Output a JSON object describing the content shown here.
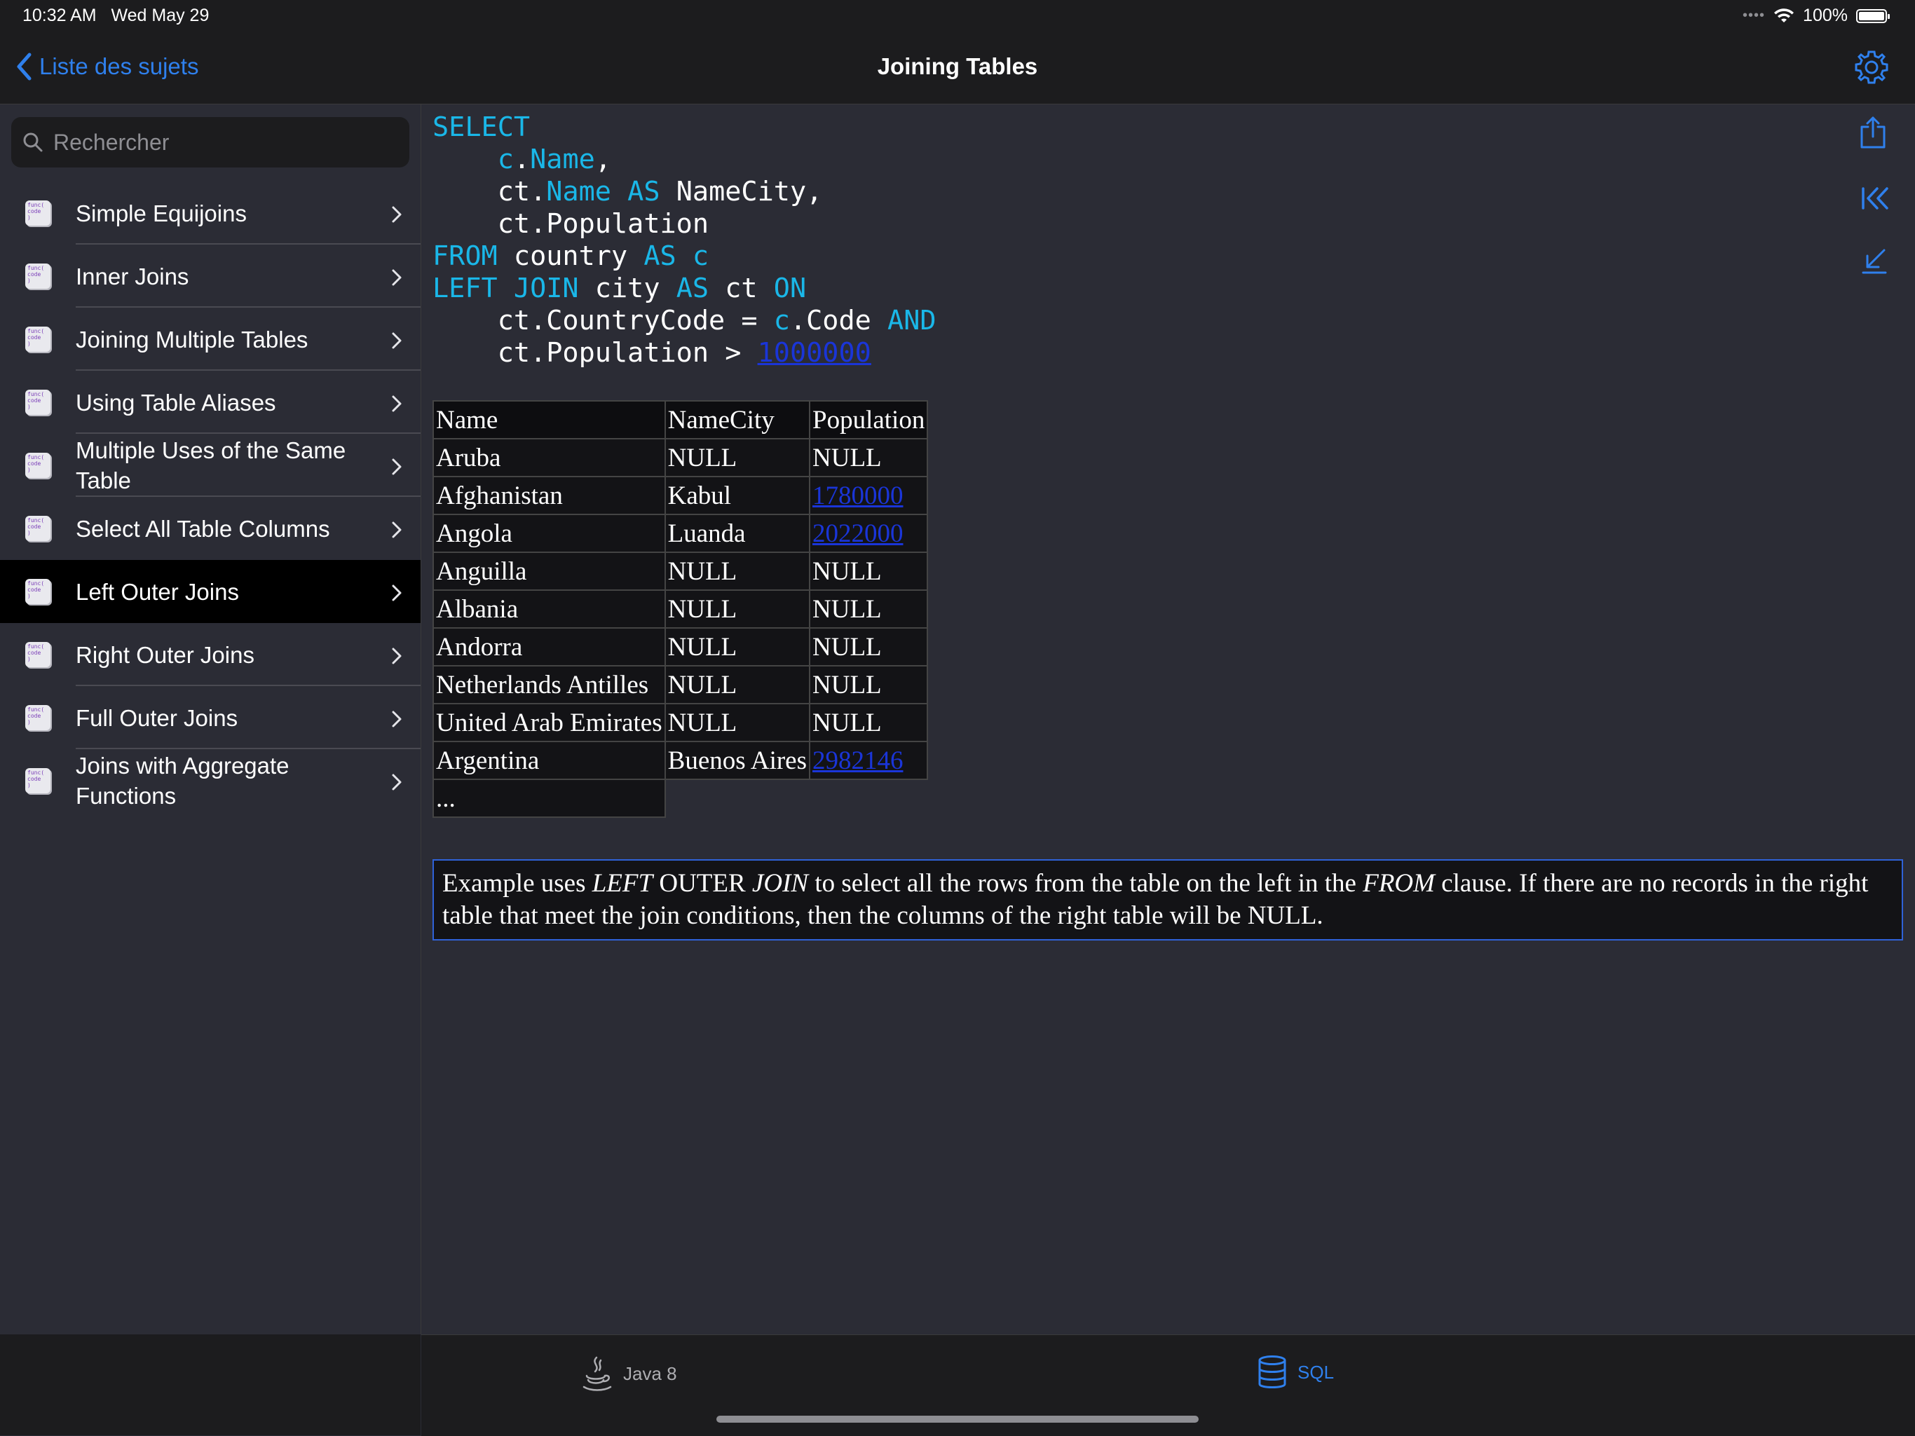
{
  "status_bar": {
    "time": "10:32 AM",
    "date": "Wed May 29",
    "signal": "••••",
    "battery": "100%"
  },
  "nav": {
    "back_label": "Liste des sujets",
    "title": "Joining Tables"
  },
  "search": {
    "placeholder": "Rechercher"
  },
  "sidebar": {
    "items": [
      {
        "label": "Simple Equijoins"
      },
      {
        "label": "Inner Joins"
      },
      {
        "label": "Joining Multiple Tables"
      },
      {
        "label": "Using Table Aliases"
      },
      {
        "label": "Multiple Uses of the Same Table"
      },
      {
        "label": "Select All Table Columns"
      },
      {
        "label": "Left Outer Joins",
        "selected": true
      },
      {
        "label": "Right Outer Joins"
      },
      {
        "label": "Full Outer Joins"
      },
      {
        "label": "Joins with Aggregate Functions"
      }
    ],
    "icon_text": "func(\ncode\n)"
  },
  "code": {
    "lines": [
      [
        [
          "kw",
          "SELECT"
        ]
      ],
      [
        [
          "t",
          "    "
        ],
        [
          "kw",
          "c"
        ],
        [
          "t",
          "."
        ],
        [
          "kw",
          "Name"
        ],
        [
          "t",
          ","
        ]
      ],
      [
        [
          "t",
          "    ct."
        ],
        [
          "kw",
          "Name"
        ],
        [
          "t",
          " "
        ],
        [
          "kw",
          "AS"
        ],
        [
          "t",
          " NameCity,"
        ]
      ],
      [
        [
          "t",
          "    ct.Population"
        ]
      ],
      [
        [
          "kw",
          "FROM"
        ],
        [
          "t",
          " country "
        ],
        [
          "kw",
          "AS"
        ],
        [
          "t",
          " "
        ],
        [
          "kw",
          "c"
        ]
      ],
      [
        [
          "kw",
          "LEFT JOIN"
        ],
        [
          "t",
          " city "
        ],
        [
          "kw",
          "AS"
        ],
        [
          "t",
          " ct "
        ],
        [
          "kw",
          "ON"
        ]
      ],
      [
        [
          "t",
          "    ct.CountryCode = "
        ],
        [
          "kw",
          "c"
        ],
        [
          "t",
          ".Code "
        ],
        [
          "kw",
          "AND"
        ]
      ],
      [
        [
          "t",
          "    ct.Population > "
        ],
        [
          "num",
          "1000000"
        ]
      ]
    ]
  },
  "result_table": {
    "headers": [
      "Name",
      "NameCity",
      "Population"
    ],
    "rows": [
      [
        "Aruba",
        "NULL",
        "NULL"
      ],
      [
        "Afghanistan",
        "Kabul",
        "1780000"
      ],
      [
        "Angola",
        "Luanda",
        "2022000"
      ],
      [
        "Anguilla",
        "NULL",
        "NULL"
      ],
      [
        "Albania",
        "NULL",
        "NULL"
      ],
      [
        "Andorra",
        "NULL",
        "NULL"
      ],
      [
        "Netherlands Antilles",
        "NULL",
        "NULL"
      ],
      [
        "United Arab Emirates",
        "NULL",
        "NULL"
      ],
      [
        "Argentina",
        "Buenos Aires",
        "2982146"
      ]
    ],
    "ellipsis": "..."
  },
  "note": {
    "parts": [
      [
        "t",
        "Example uses "
      ],
      [
        "i",
        "LEFT"
      ],
      [
        "t",
        " OUTER "
      ],
      [
        "i",
        "JOIN"
      ],
      [
        "t",
        " to select all the rows from the table on the left in the "
      ],
      [
        "i",
        "FROM"
      ],
      [
        "t",
        " clause. If there are no records in the right table that meet the join conditions, then the columns of the right table will be NULL."
      ]
    ]
  },
  "tabs": [
    {
      "label": "Java 8",
      "icon": "java-cup-icon",
      "active": false
    },
    {
      "label": "SQL",
      "icon": "database-icon",
      "active": true
    }
  ],
  "colors": {
    "accent": "#2f80ed",
    "keyword": "#1ab7e8",
    "link": "#1a35d8",
    "background": "#2b2c35",
    "bar": "#1c1c1e"
  }
}
